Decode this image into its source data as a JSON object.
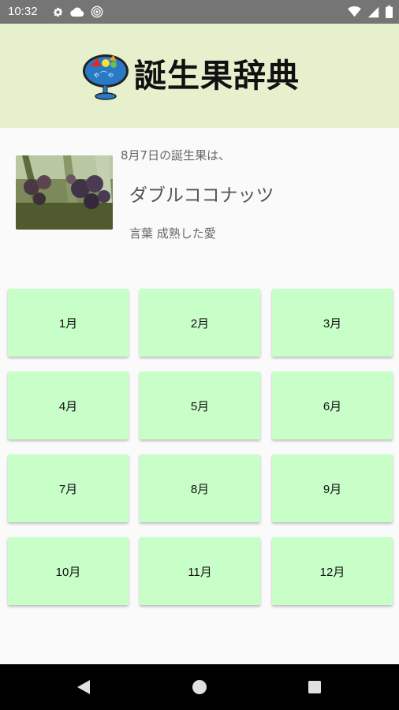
{
  "status_bar": {
    "time": "10:32",
    "icons_left": [
      "gear-icon",
      "cloud-icon",
      "target-icon"
    ],
    "icons_right": [
      "wifi-icon",
      "signal-icon",
      "battery-icon"
    ]
  },
  "header": {
    "title": "誕生果辞典"
  },
  "today": {
    "date_text": "8月7日の誕生果は、",
    "fruit_name": "ダブルココナッツ",
    "meaning_text": "言葉  成熟した愛"
  },
  "months": [
    "1月",
    "2月",
    "3月",
    "4月",
    "5月",
    "6月",
    "7月",
    "8月",
    "9月",
    "10月",
    "11月",
    "12月"
  ],
  "nav_bar": {
    "icons": [
      "back-icon",
      "home-icon",
      "recents-icon"
    ]
  },
  "colors": {
    "status_bar": "#757575",
    "header_bg": "#e6f0cd",
    "month_button_bg": "#c8ffc8",
    "nav_bar": "#000000"
  }
}
